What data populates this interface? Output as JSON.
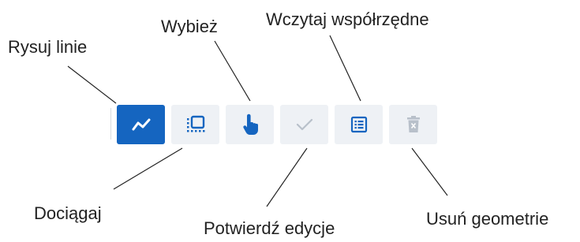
{
  "colors": {
    "active_bg": "#1565c0",
    "button_bg": "#eef1f5",
    "icon_enabled": "#1565c0",
    "icon_disabled": "#b8c0ca",
    "icon_on_active": "#ffffff",
    "callout_line": "#222222"
  },
  "toolbar": {
    "buttons": [
      {
        "id": "draw_line",
        "icon": "polyline-icon",
        "state": "active",
        "callout": "Rysuj linie"
      },
      {
        "id": "snap",
        "icon": "snap-square-icon",
        "state": "enabled",
        "callout": "Dociągaj"
      },
      {
        "id": "select",
        "icon": "pointer-hand-icon",
        "state": "enabled",
        "callout": "Wybież"
      },
      {
        "id": "confirm",
        "icon": "checkmark-icon",
        "state": "disabled",
        "callout": "Potwierdź edycje"
      },
      {
        "id": "load_coords",
        "icon": "list-icon",
        "state": "enabled",
        "callout": "Wczytaj współrzędne"
      },
      {
        "id": "delete_geometry",
        "icon": "trash-icon",
        "state": "disabled",
        "callout": "Usuń geometrie"
      }
    ]
  }
}
